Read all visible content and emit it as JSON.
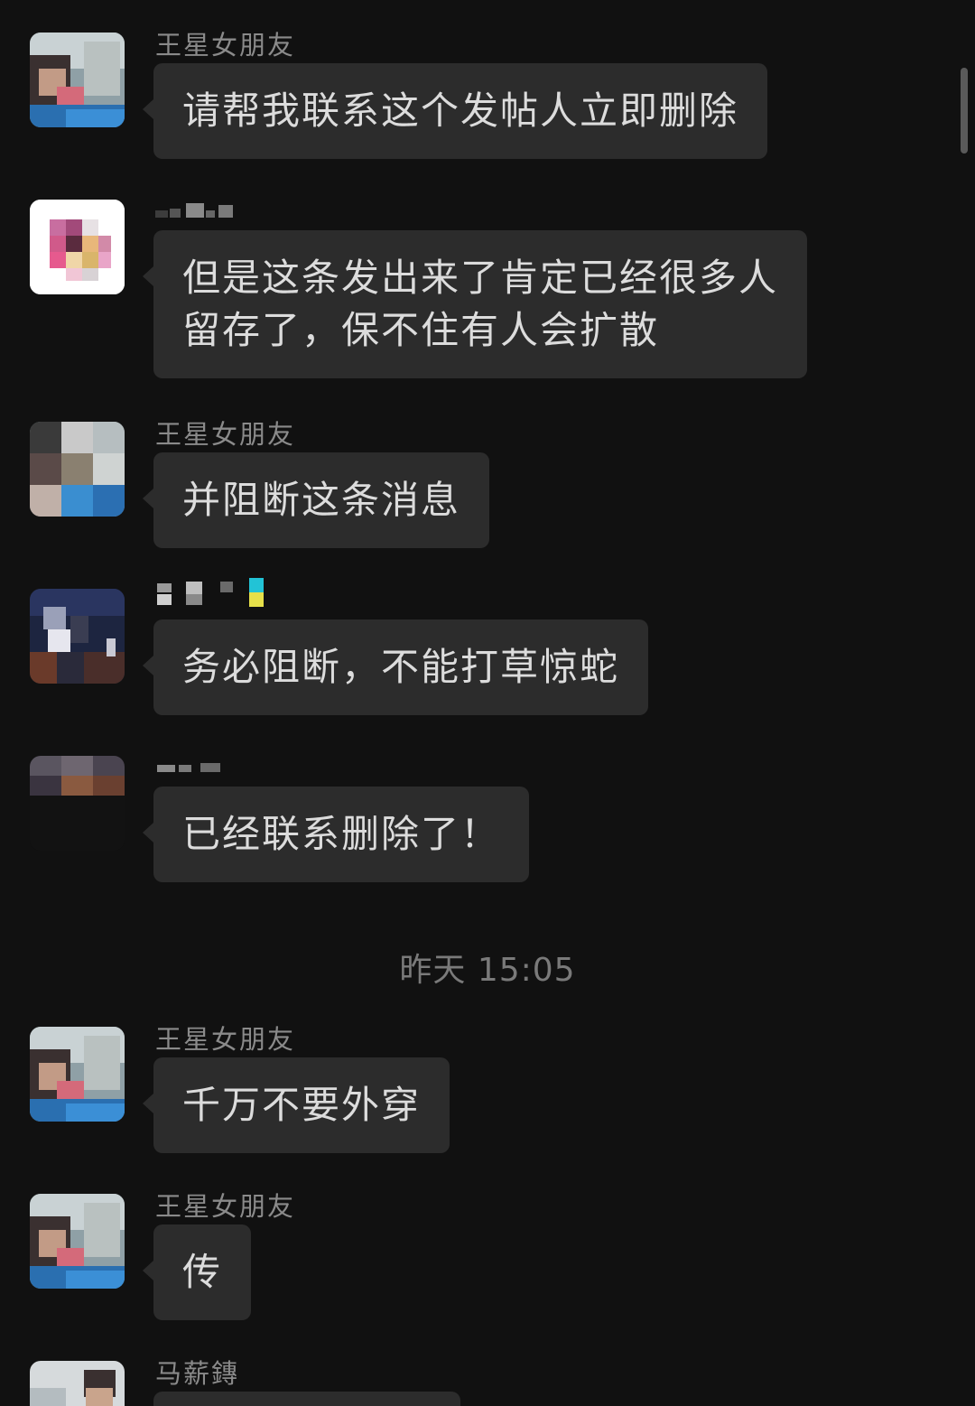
{
  "messages": [
    {
      "sender": "王星女朋友",
      "text": "请帮我联系这个发帖人立即删除"
    },
    {
      "sender": "",
      "text_line1": "但是这条发出来了肯定已经很多人",
      "text_line2": "留存了，保不住有人会扩散"
    },
    {
      "sender": "王星女朋友",
      "text": "并阻断这条消息"
    },
    {
      "sender": "",
      "text": "务必阻断，不能打草惊蛇"
    },
    {
      "sender": "",
      "text": "已经联系删除了！"
    },
    {
      "sender": "王星女朋友",
      "text": "千万不要外穿"
    },
    {
      "sender": "王星女朋友",
      "text": "传"
    },
    {
      "sender": "马薪鏄",
      "text": ""
    }
  ],
  "timestamp": "昨天 15:05"
}
